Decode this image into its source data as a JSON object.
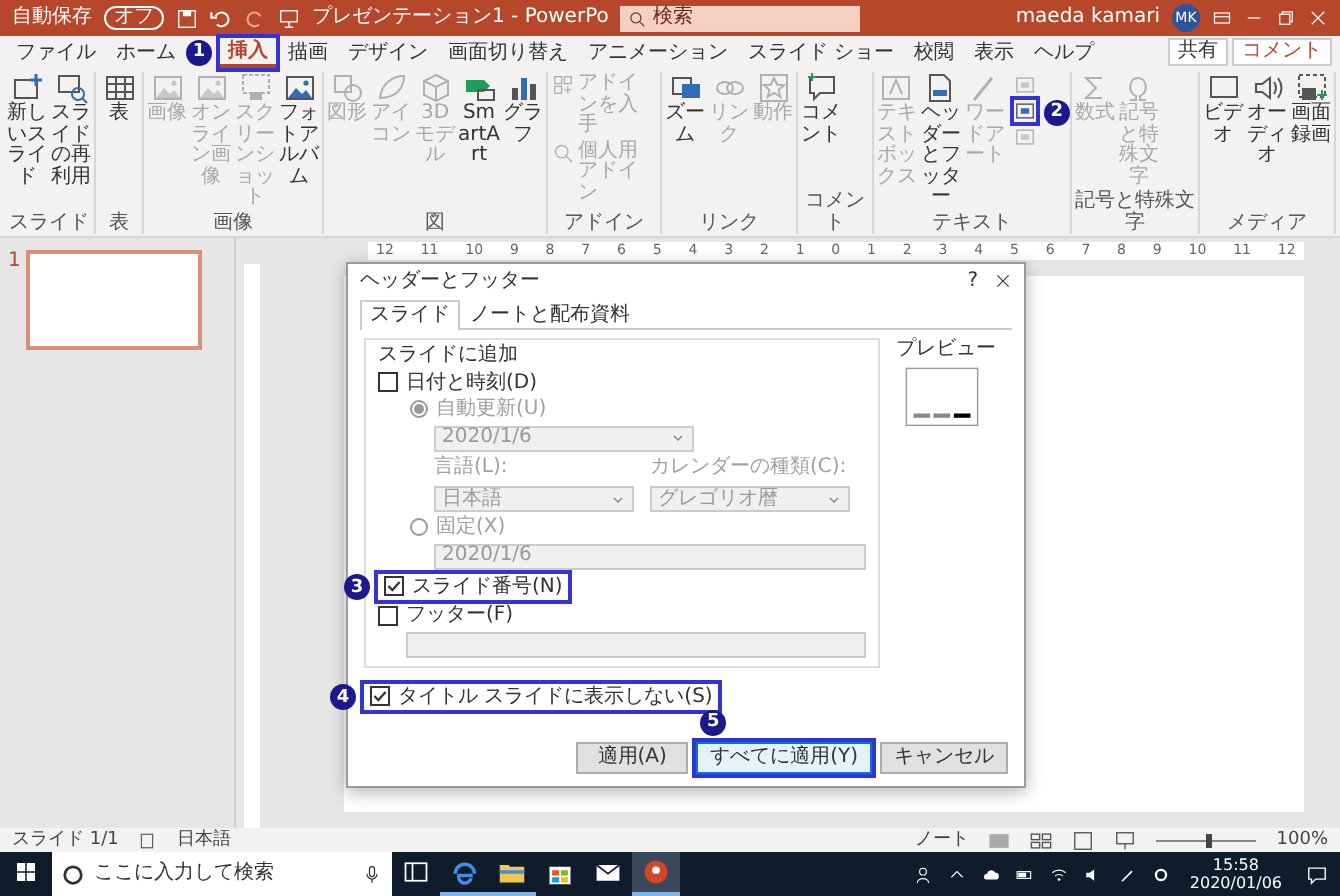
{
  "title_bar": {
    "autosave_label": "自動保存",
    "autosave_state": "オフ",
    "autosave_on": false,
    "document_title": "プレゼンテーション1 - PowerPo",
    "search_placeholder": "検索",
    "user_name": "maeda kamari",
    "user_initials": "MK"
  },
  "tabs": [
    {
      "label": "ファイル",
      "selected": false
    },
    {
      "label": "ホーム",
      "selected": false
    },
    {
      "label": "挿入",
      "selected": true,
      "annotation": "1"
    },
    {
      "label": "描画",
      "selected": false
    },
    {
      "label": "デザイン",
      "selected": false
    },
    {
      "label": "画面切り替え",
      "selected": false
    },
    {
      "label": "アニメーション",
      "selected": false
    },
    {
      "label": "スライド ショー",
      "selected": false
    },
    {
      "label": "校閲",
      "selected": false
    },
    {
      "label": "表示",
      "selected": false
    },
    {
      "label": "ヘルプ",
      "selected": false
    }
  ],
  "share_button": "共有",
  "comment_button": "コメント",
  "ribbon": [
    {
      "label": "スライド",
      "items": [
        {
          "kind": "button",
          "label": "新しいスライド",
          "disabled": false
        },
        {
          "kind": "button",
          "label": "スライドの再利用",
          "disabled": false
        }
      ]
    },
    {
      "label": "表",
      "items": [
        {
          "kind": "button",
          "label": "表",
          "disabled": false
        }
      ]
    },
    {
      "label": "画像",
      "items": [
        {
          "kind": "button",
          "label": "画像",
          "disabled": true
        },
        {
          "kind": "button",
          "label": "オンライン画像",
          "disabled": true
        },
        {
          "kind": "button",
          "label": "スクリーンショット",
          "disabled": true
        },
        {
          "kind": "button",
          "label": "フォトアルバム",
          "disabled": false
        }
      ]
    },
    {
      "label": "図",
      "items": [
        {
          "kind": "button",
          "label": "図形",
          "disabled": true
        },
        {
          "kind": "button",
          "label": "アイコン",
          "disabled": true
        },
        {
          "kind": "button",
          "label": "3Dモデル",
          "disabled": true
        },
        {
          "kind": "button",
          "label": "SmartArt",
          "disabled": false
        },
        {
          "kind": "button",
          "label": "グラフ",
          "disabled": false
        }
      ]
    },
    {
      "label": "アドイン",
      "items": [
        {
          "kind": "small",
          "label": "アドインを入手",
          "disabled": true
        },
        {
          "kind": "small",
          "label": "個人用アドイン",
          "disabled": true
        }
      ]
    },
    {
      "label": "リンク",
      "items": [
        {
          "kind": "button",
          "label": "ズーム",
          "disabled": false
        },
        {
          "kind": "button",
          "label": "リンク",
          "disabled": true
        },
        {
          "kind": "button",
          "label": "動作",
          "disabled": true
        }
      ]
    },
    {
      "label": "コメント",
      "items": [
        {
          "kind": "button",
          "label": "コメント",
          "disabled": false
        }
      ]
    },
    {
      "label": "テキスト",
      "items": [
        {
          "kind": "button",
          "label": "テキストボックス",
          "disabled": true
        },
        {
          "kind": "button",
          "label": "ヘッダーとフッター",
          "disabled": false
        },
        {
          "kind": "button",
          "label": "ワードアート",
          "disabled": true
        },
        {
          "kind": "icon_stack",
          "icons": [
            {
              "disabled": true
            },
            {
              "disabled": false,
              "annotation": "2"
            },
            {
              "disabled": true
            }
          ]
        }
      ]
    },
    {
      "label": "記号と特殊文字",
      "items": [
        {
          "kind": "button",
          "label": "数式",
          "disabled": true
        },
        {
          "kind": "button",
          "label": "記号と特殊文字",
          "disabled": true
        }
      ]
    },
    {
      "label": "メディア",
      "items": [
        {
          "kind": "button",
          "label": "ビデオ",
          "disabled": false
        },
        {
          "kind": "button",
          "label": "オーディオ",
          "disabled": false
        },
        {
          "kind": "button",
          "label": "画面録画",
          "disabled": false
        }
      ]
    }
  ],
  "ruler_labels": [
    "12",
    "11",
    "10",
    "9",
    "8",
    "7",
    "6",
    "5",
    "4",
    "3",
    "2",
    "1",
    "0",
    "1",
    "2",
    "3",
    "4",
    "5",
    "6",
    "7",
    "8",
    "9",
    "10",
    "11",
    "12"
  ],
  "slides": [
    {
      "number": "1",
      "selected": true
    }
  ],
  "dialog": {
    "title": "ヘッダーとフッター",
    "help": "?",
    "tabs": [
      {
        "label": "スライド",
        "selected": true
      },
      {
        "label": "ノートと配布資料",
        "selected": false
      }
    ],
    "group_label": "スライドに追加",
    "date_time": {
      "label": "日付と時刻(D)",
      "checked": false
    },
    "auto_update": {
      "label": "自動更新(U)",
      "selected": true
    },
    "date_value": "2020/1/6",
    "language_label": "言語(L):",
    "language_value": "日本語",
    "calendar_label": "カレンダーの種類(C):",
    "calendar_value": "グレゴリオ暦",
    "fixed": {
      "label": "固定(X)",
      "selected": false
    },
    "fixed_value": "2020/1/6",
    "slide_number": {
      "label": "スライド番号(N)",
      "checked": true,
      "annotation": "3"
    },
    "footer": {
      "label": "フッター(F)",
      "checked": false
    },
    "hide_on_title": {
      "label": "タイトル スライドに表示しない(S)",
      "checked": true,
      "annotation": "4"
    },
    "preview_label": "プレビュー",
    "buttons": [
      {
        "label": "適用(A)",
        "default": false
      },
      {
        "label": "すべてに適用(Y)",
        "default": true,
        "annotation": "5"
      },
      {
        "label": "キャンセル",
        "default": false
      }
    ]
  },
  "status_bar": {
    "slide": "スライド 1/1",
    "language": "日本語",
    "notes": "ノート",
    "zoom": {
      "reading": "100%",
      "level": 0.5
    }
  },
  "taskbar": {
    "search_placeholder": "ここに入力して検索",
    "apps": [
      {
        "running": false,
        "selected": false
      },
      {
        "running": true,
        "selected": false
      },
      {
        "running": true,
        "selected": false
      },
      {
        "running": false,
        "selected": false
      },
      {
        "running": false,
        "selected": false
      },
      {
        "running": true,
        "selected": true
      }
    ],
    "time": "15:58",
    "date": "2020/01/06"
  }
}
